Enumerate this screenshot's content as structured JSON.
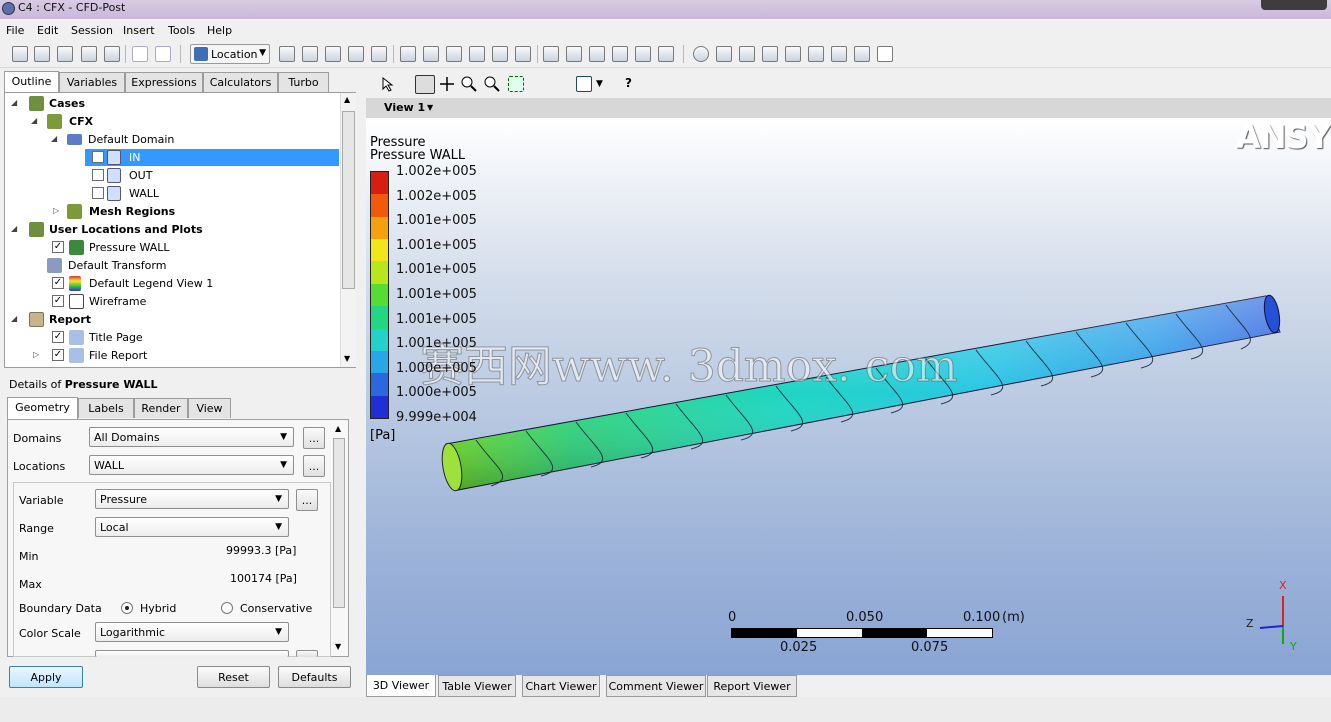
{
  "window": {
    "title": "C4 : CFX - CFD-Post"
  },
  "menu": [
    "File",
    "Edit",
    "Session",
    "Insert",
    "Tools",
    "Help"
  ],
  "toolbar": {
    "location_label": "Location"
  },
  "left_tabs": [
    "Outline",
    "Variables",
    "Expressions",
    "Calculators",
    "Turbo"
  ],
  "tree": {
    "cases": "Cases",
    "cfx": "CFX",
    "default_domain": "Default Domain",
    "in": "IN",
    "out": "OUT",
    "wall": "WALL",
    "mesh_regions": "Mesh Regions",
    "user_locations": "User Locations and Plots",
    "pressure_wall": "Pressure WALL",
    "default_transform": "Default Transform",
    "default_legend": "Default Legend View 1",
    "wireframe": "Wireframe",
    "report": "Report",
    "title_page": "Title Page",
    "file_report": "File Report"
  },
  "details": {
    "prefix": "Details of ",
    "object": "Pressure WALL",
    "tabs": [
      "Geometry",
      "Labels",
      "Render",
      "View"
    ],
    "domains_label": "Domains",
    "domains_value": "All Domains",
    "locations_label": "Locations",
    "locations_value": "WALL",
    "variable_label": "Variable",
    "variable_value": "Pressure",
    "range_label": "Range",
    "range_value": "Local",
    "min_label": "Min",
    "min_value": "99993.3 [Pa]",
    "max_label": "Max",
    "max_value": "100174 [Pa]",
    "boundary_label": "Boundary Data",
    "hybrid": "Hybrid",
    "conservative": "Conservative",
    "colorscale_label": "Color Scale",
    "colorscale_value": "Logarithmic",
    "dots": "..."
  },
  "buttons": {
    "apply": "Apply",
    "reset": "Reset",
    "defaults": "Defaults"
  },
  "viewer": {
    "view_label": "View 1",
    "legend_title": "Pressure",
    "legend_sub": "Pressure WALL",
    "legend_values": [
      "1.002e+005",
      "1.002e+005",
      "1.001e+005",
      "1.001e+005",
      "1.001e+005",
      "1.001e+005",
      "1.001e+005",
      "1.001e+005",
      "1.000e+005",
      "1.000e+005",
      "9.999e+004"
    ],
    "legend_unit": "[Pa]",
    "legend_colors": [
      "#d81e10",
      "#f05a0a",
      "#f5a10f",
      "#f2e51a",
      "#b7e61c",
      "#56dd33",
      "#23d681",
      "#22d2c8",
      "#27a6ea",
      "#2a68e0",
      "#1e2fd5"
    ],
    "logo": "ANSY",
    "watermark": "赛西网www. 3dmox. com",
    "scale_top": [
      "0",
      "0.050",
      "0.100",
      "(m)"
    ],
    "scale_bottom": [
      "0.025",
      "0.075"
    ],
    "axis_x": "X",
    "axis_y": "Y",
    "axis_z": "Z"
  },
  "bottom_tabs": [
    "3D Viewer",
    "Table Viewer",
    "Chart Viewer",
    "Comment Viewer",
    "Report Viewer"
  ]
}
